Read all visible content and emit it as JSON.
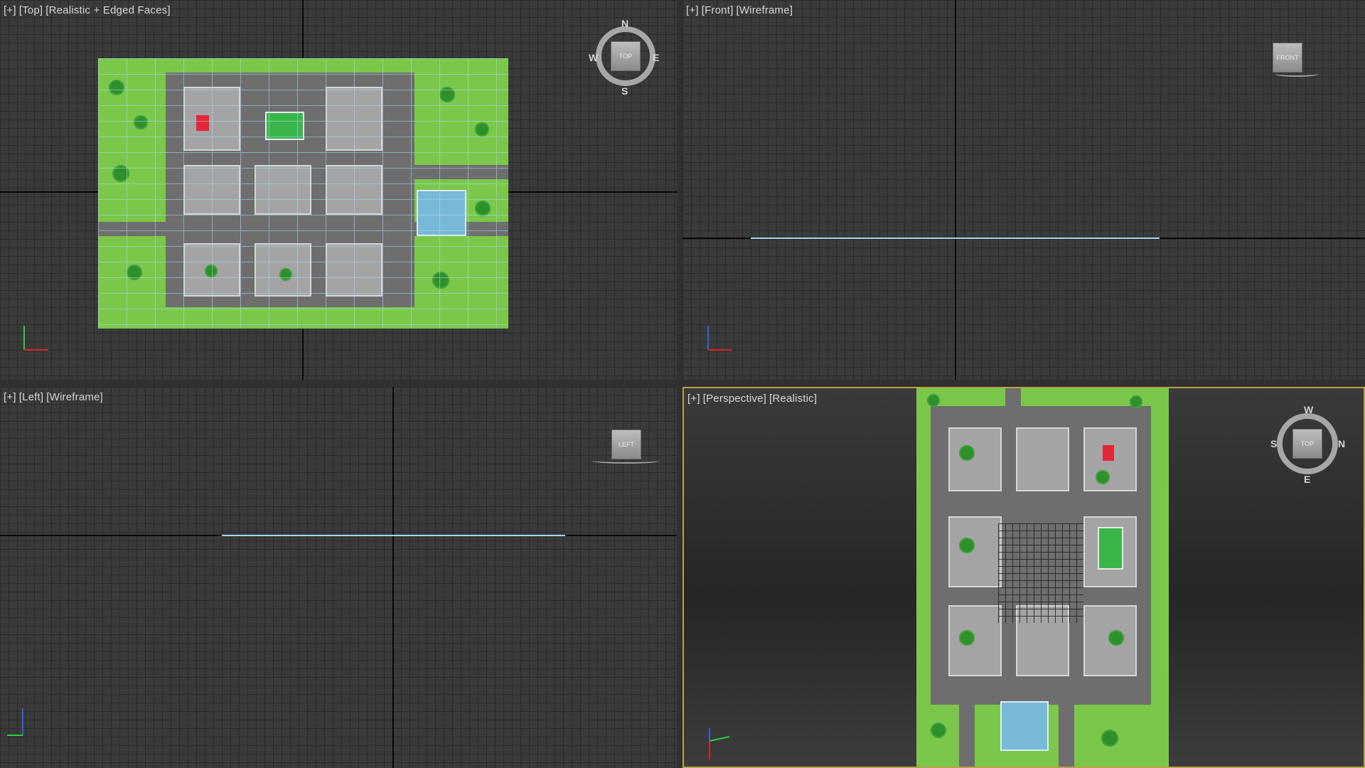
{
  "viewports": {
    "top": {
      "plus": "[+]",
      "view": "[Top]",
      "shading": "[Realistic + Edged Faces]",
      "cube_label": "TOP",
      "compass": {
        "n": "N",
        "s": "S",
        "e": "E",
        "w": "W"
      }
    },
    "front": {
      "plus": "[+]",
      "view": "[Front]",
      "shading": "[Wireframe]",
      "cube_label": "FRONT"
    },
    "left": {
      "plus": "[+]",
      "view": "[Left]",
      "shading": "[Wireframe]",
      "cube_label": "LEFT"
    },
    "perspective": {
      "plus": "[+]",
      "view": "[Perspective]",
      "shading": "[Realistic]",
      "cube_label": "TOP",
      "compass": {
        "n": "N",
        "s": "S",
        "e": "E",
        "w": "W"
      }
    }
  },
  "axes": {
    "x": "x",
    "y": "y",
    "z": "z"
  },
  "colors": {
    "grid_bg": "#3a3a3a",
    "grid_line": "#2a2a2a",
    "active_border": "#b8a24a",
    "selection": "#9fd7ef",
    "grass": "#7bc74a"
  }
}
